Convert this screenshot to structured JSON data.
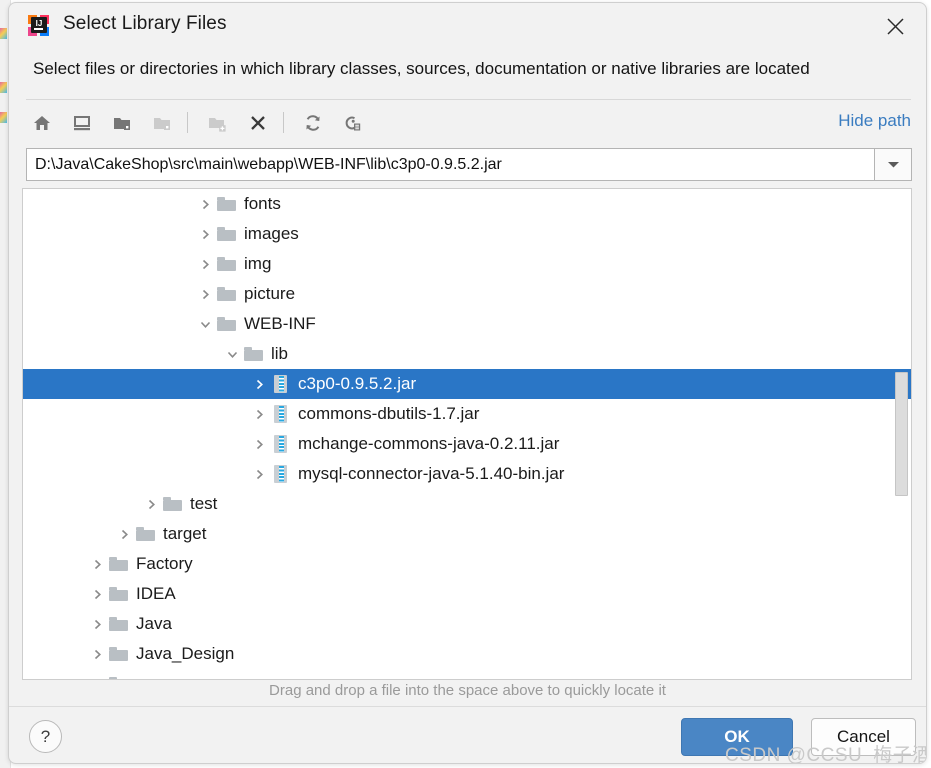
{
  "window": {
    "app_icon": "intellij-idea-logo",
    "title": "Select Library Files",
    "close_label": "✕"
  },
  "subtitle": "Select files or directories in which library classes, sources, documentation or native libraries are located",
  "toolbar": {
    "items": [
      {
        "name": "home-icon",
        "tooltip": "Home",
        "enabled": true
      },
      {
        "name": "desktop-icon",
        "tooltip": "Desktop",
        "enabled": true
      },
      {
        "name": "project-folder-icon",
        "tooltip": "Project",
        "enabled": true
      },
      {
        "name": "module-folder-icon",
        "tooltip": "Module",
        "enabled": false
      },
      {
        "name": "new-folder-icon",
        "tooltip": "New Folder",
        "enabled": false
      },
      {
        "name": "delete-icon",
        "tooltip": "Delete",
        "enabled": true
      },
      {
        "name": "refresh-icon",
        "tooltip": "Refresh",
        "enabled": true
      },
      {
        "name": "show-hidden-icon",
        "tooltip": "Show Hidden Files",
        "enabled": true
      }
    ],
    "hide_path_label": "Hide path"
  },
  "path_field": {
    "value": "D:\\Java\\CakeShop\\src\\main\\webapp\\WEB-INF\\lib\\c3p0-0.9.5.2.jar",
    "placeholder": "",
    "dropdown_icon": "chevron-down-icon"
  },
  "tree": {
    "rows": [
      {
        "label": "fonts",
        "icon": "folder",
        "indent": 6,
        "twisty": "collapsed",
        "selected": false
      },
      {
        "label": "images",
        "icon": "folder",
        "indent": 6,
        "twisty": "collapsed",
        "selected": false
      },
      {
        "label": "img",
        "icon": "folder",
        "indent": 6,
        "twisty": "collapsed",
        "selected": false
      },
      {
        "label": "picture",
        "icon": "folder",
        "indent": 6,
        "twisty": "collapsed",
        "selected": false
      },
      {
        "label": "WEB-INF",
        "icon": "folder",
        "indent": 6,
        "twisty": "expanded",
        "selected": false
      },
      {
        "label": "lib",
        "icon": "folder",
        "indent": 7,
        "twisty": "expanded",
        "selected": false
      },
      {
        "label": "c3p0-0.9.5.2.jar",
        "icon": "jar",
        "indent": 8,
        "twisty": "collapsed",
        "selected": true
      },
      {
        "label": "commons-dbutils-1.7.jar",
        "icon": "jar",
        "indent": 8,
        "twisty": "collapsed",
        "selected": false
      },
      {
        "label": "mchange-commons-java-0.2.11.jar",
        "icon": "jar",
        "indent": 8,
        "twisty": "collapsed",
        "selected": false
      },
      {
        "label": "mysql-connector-java-5.1.40-bin.jar",
        "icon": "jar",
        "indent": 8,
        "twisty": "collapsed",
        "selected": false
      },
      {
        "label": "test",
        "icon": "folder",
        "indent": 4,
        "twisty": "collapsed",
        "selected": false
      },
      {
        "label": "target",
        "icon": "folder",
        "indent": 3,
        "twisty": "collapsed",
        "selected": false
      },
      {
        "label": "Factory",
        "icon": "folder",
        "indent": 2,
        "twisty": "collapsed",
        "selected": false
      },
      {
        "label": "IDEA",
        "icon": "folder",
        "indent": 2,
        "twisty": "collapsed",
        "selected": false
      },
      {
        "label": "Java",
        "icon": "folder",
        "indent": 2,
        "twisty": "collapsed",
        "selected": false
      },
      {
        "label": "Java_Design",
        "icon": "folder",
        "indent": 2,
        "twisty": "collapsed",
        "selected": false
      },
      {
        "label": "",
        "icon": "folder",
        "indent": 2,
        "twisty": "collapsed",
        "selected": false
      }
    ]
  },
  "hint": "Drag and drop a file into the space above to quickly locate it",
  "footer": {
    "help_label": "?",
    "ok_label": "OK",
    "cancel_label": "Cancel"
  },
  "watermark": "CSDN @CCSU_梅子酒",
  "colors": {
    "selection_blue": "#2a76c6",
    "link_blue": "#3a7cc0",
    "ok_button": "#4a86c5",
    "dialog_bg": "#f2f2f2",
    "tree_bg": "#ffffff"
  }
}
